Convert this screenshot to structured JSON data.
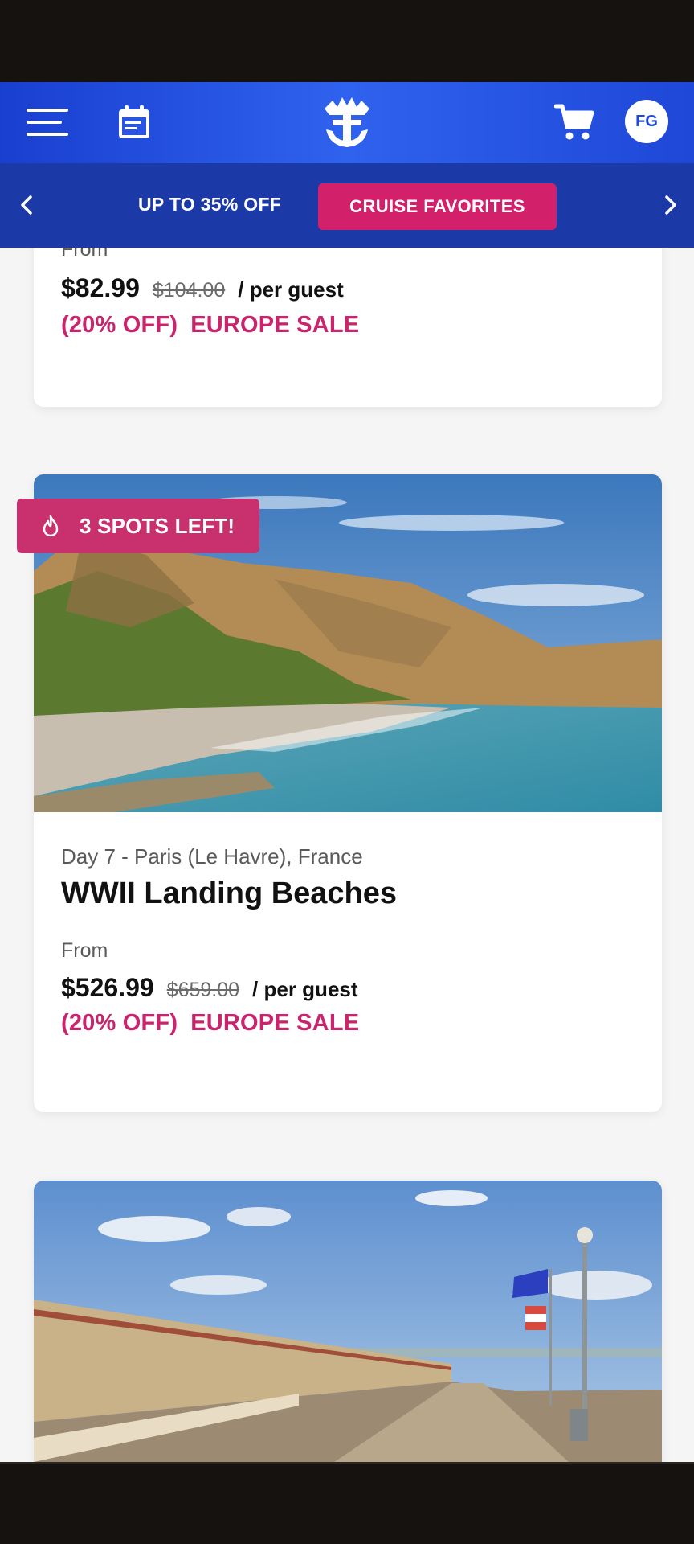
{
  "header": {
    "menu_icon": "hamburger-icon",
    "calendar_icon": "calendar-icon",
    "logo_icon": "crown-anchor-logo",
    "cart_icon": "cart-icon",
    "avatar_initials": "FG",
    "colors": {
      "primary": "#1f47d8",
      "accent": "#d2206b"
    }
  },
  "promo": {
    "text": "UP TO 35% OFF",
    "button_label": "CRUISE FAVORITES",
    "prev_icon": "chevron-left-icon",
    "next_icon": "chevron-right-icon"
  },
  "cards": [
    {
      "from_label": "From",
      "price": "$82.99",
      "original_price": "$104.00",
      "per_guest": "/ per guest",
      "discount": "(20% OFF)",
      "sale_name": "EUROPE SALE"
    },
    {
      "badge": "3 SPOTS LEFT!",
      "badge_icon": "flame-icon",
      "day_location": "Day 7 - Paris (Le Havre), France",
      "title": "WWII Landing Beaches",
      "from_label": "From",
      "price": "$526.99",
      "original_price": "$659.00",
      "per_guest": "/ per guest",
      "discount": "(20% OFF)",
      "sale_name": "EUROPE SALE"
    }
  ]
}
